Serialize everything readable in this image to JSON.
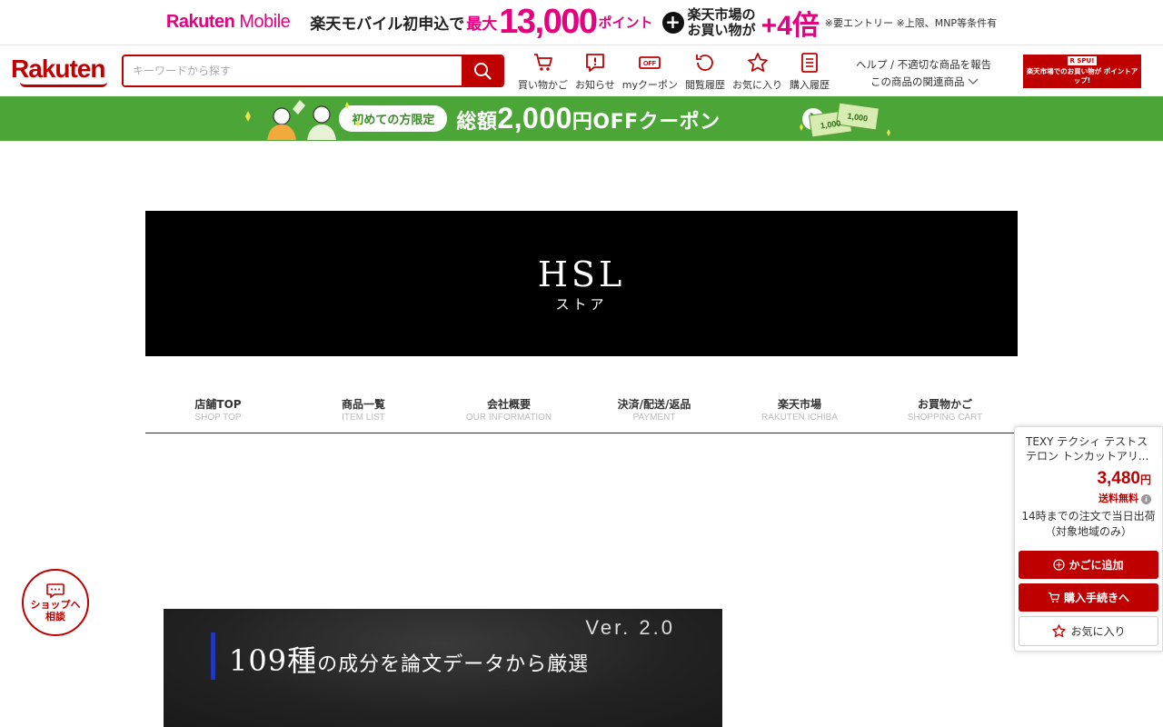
{
  "promo": {
    "logo_a": "Rakuten",
    "logo_b": " Mobile",
    "text1": "楽天モバイル初申込で",
    "text2": "最大",
    "amount": "13,000",
    "unit": "ポイント",
    "plus": "+",
    "line_a": "楽天市場の",
    "line_b": "お買い物が",
    "mult": "+4倍",
    "note": "※要エントリー ※上限、MNP等条件有"
  },
  "header": {
    "logo": "Rakuten",
    "search_placeholder": "キーワードから探す",
    "nav": [
      {
        "label": "買い物かご",
        "icon": "cart-icon"
      },
      {
        "label": "お知らせ",
        "icon": "notice-icon"
      },
      {
        "label": "myクーポン",
        "icon": "coupon-icon"
      },
      {
        "label": "閲覧履歴",
        "icon": "history-icon"
      },
      {
        "label": "お気に入り",
        "icon": "star-icon"
      },
      {
        "label": "購入履歴",
        "icon": "list-icon"
      }
    ],
    "help": "ヘルプ / 不適切な商品を報告",
    "related": "この商品の関連商品",
    "spu_title": "R SPU!",
    "spu_text": "楽天市場でのお買い物が ポイントアップ!"
  },
  "coupon": {
    "pill": "初めての方限定",
    "pre": "総額",
    "amount": "2,000",
    "post": "円OFFクーポン",
    "bill_a": "1,000",
    "bill_b": "1,000"
  },
  "store": {
    "name": "HSL",
    "sub": "ストア"
  },
  "store_nav": [
    {
      "jp": "店舗TOP",
      "en": "SHOP TOP"
    },
    {
      "jp": "商品一覧",
      "en": "ITEM LIST"
    },
    {
      "jp": "会社概要",
      "en": "OUR INFORMATION"
    },
    {
      "jp": "決済/配送/返品",
      "en": "PAYMENT"
    },
    {
      "jp": "楽天市場",
      "en": "RAKUTEN ICHIBA"
    },
    {
      "jp": "お買物かご",
      "en": "SHOPPING CART"
    }
  ],
  "product_image": {
    "version": "Ver. 2.0",
    "headline_a": "109種",
    "headline_b": "の成分を論文データから厳選"
  },
  "consult": {
    "line1": "ショップへ",
    "line2": "相談"
  },
  "cart_panel": {
    "title": "TEXY テクシィ テストステロン トンカットアリ...",
    "price": "3,480",
    "yen": "円",
    "shipping": "送料無料",
    "eta": "14時までの注文で当日出荷（対象地域のみ）",
    "add_cart": "かごに追加",
    "checkout": "購入手続きへ",
    "favorite": "お気に入り"
  },
  "colors": {
    "rakuten_red": "#bf0000",
    "mobile_pink": "#e5007f",
    "coupon_green": "#4ca637"
  }
}
